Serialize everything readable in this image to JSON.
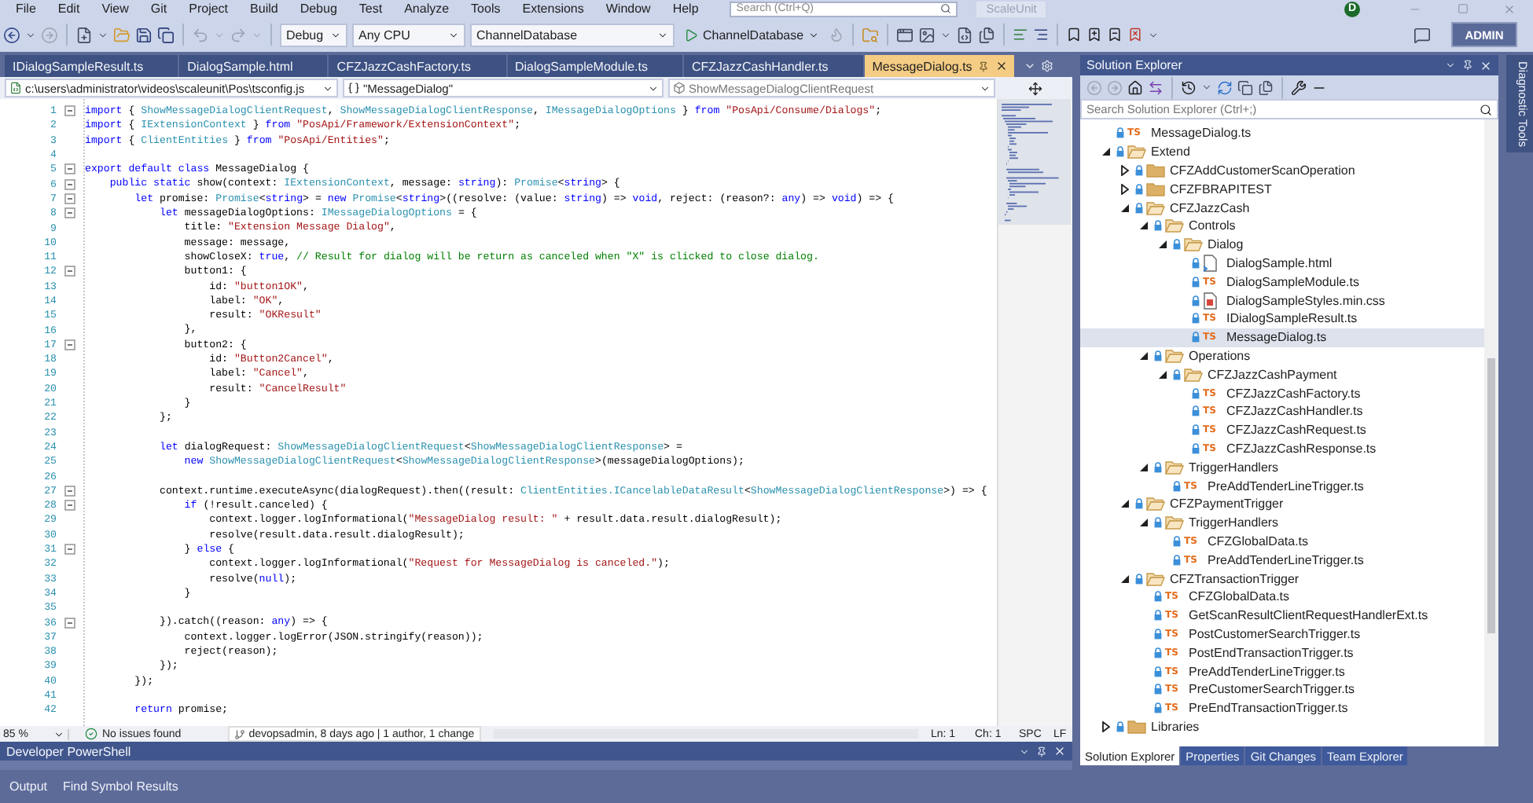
{
  "menu": [
    "File",
    "Edit",
    "View",
    "Git",
    "Project",
    "Build",
    "Debug",
    "Test",
    "Analyze",
    "Tools",
    "Extensions",
    "Window",
    "Help"
  ],
  "search": {
    "placeholder": "Search (Ctrl+Q)"
  },
  "solution_name": "ScaleUnit",
  "account": {
    "initial": "D"
  },
  "toolbar": {
    "configuration": "Debug",
    "platform": "Any CPU",
    "startup_project": "ChannelDatabase",
    "run_target": "ChannelDatabase",
    "admin": "ADMIN"
  },
  "editor_tabs": [
    {
      "label": "IDialogSampleResult.ts",
      "selected": false
    },
    {
      "label": "DialogSample.html",
      "selected": false
    },
    {
      "label": "CFZJazzCashFactory.ts",
      "selected": false
    },
    {
      "label": "DialogSampleModule.ts",
      "selected": false
    },
    {
      "label": "CFZJazzCashHandler.ts",
      "selected": false
    },
    {
      "label": "MessageDialog.ts",
      "selected": true
    }
  ],
  "navigation": {
    "file": "c:\\users\\administrator\\videos\\scaleunit\\Pos\\tsconfig.js",
    "scope": "\"MessageDialog\"",
    "member": "ShowMessageDialogClientRequest"
  },
  "code_lines": [
    {
      "number": "1",
      "foldable": true,
      "segments": [
        {
          "kind": "keyword",
          "text": "import"
        },
        {
          "kind": "plain",
          "text": " { "
        },
        {
          "kind": "type",
          "text": "ShowMessageDialogClientRequest"
        },
        {
          "kind": "plain",
          "text": ", "
        },
        {
          "kind": "type",
          "text": "ShowMessageDialogClientResponse"
        },
        {
          "kind": "plain",
          "text": ", "
        },
        {
          "kind": "type",
          "text": "IMessageDialogOptions"
        },
        {
          "kind": "plain",
          "text": " } "
        },
        {
          "kind": "keyword",
          "text": "from"
        },
        {
          "kind": "string",
          "text": " \"PosApi/Consume/Dialogs\""
        },
        {
          "kind": "plain",
          "text": ";"
        }
      ]
    },
    {
      "number": "2",
      "foldable": false,
      "segments": [
        {
          "kind": "keyword",
          "text": "import"
        },
        {
          "kind": "plain",
          "text": " { "
        },
        {
          "kind": "type",
          "text": "IExtensionContext"
        },
        {
          "kind": "plain",
          "text": " } "
        },
        {
          "kind": "keyword",
          "text": "from"
        },
        {
          "kind": "string",
          "text": " \"PosApi/Framework/ExtensionContext\""
        },
        {
          "kind": "plain",
          "text": ";"
        }
      ]
    },
    {
      "number": "3",
      "foldable": false,
      "segments": [
        {
          "kind": "keyword",
          "text": "import"
        },
        {
          "kind": "plain",
          "text": " { "
        },
        {
          "kind": "type",
          "text": "ClientEntities"
        },
        {
          "kind": "plain",
          "text": " } "
        },
        {
          "kind": "keyword",
          "text": "from"
        },
        {
          "kind": "string",
          "text": " \"PosApi/Entities\""
        },
        {
          "kind": "plain",
          "text": ";"
        }
      ]
    },
    {
      "number": "4",
      "foldable": false
    },
    {
      "number": "5",
      "foldable": true,
      "segments": [
        {
          "kind": "keyword",
          "text": "export default class"
        },
        {
          "kind": "plain",
          "text": " MessageDialog {"
        }
      ]
    },
    {
      "number": "6",
      "foldable": true,
      "segments": [
        {
          "kind": "keyword",
          "text": "    public static"
        },
        {
          "kind": "plain",
          "text": " show(context: "
        },
        {
          "kind": "type",
          "text": "IExtensionContext"
        },
        {
          "kind": "plain",
          "text": ", message: "
        },
        {
          "kind": "keyword",
          "text": "string"
        },
        {
          "kind": "plain",
          "text": "): "
        },
        {
          "kind": "type",
          "text": "Promise"
        },
        {
          "kind": "plain",
          "text": "<"
        },
        {
          "kind": "keyword",
          "text": "string"
        },
        {
          "kind": "plain",
          "text": "> {"
        }
      ]
    },
    {
      "number": "7",
      "foldable": true,
      "segments": [
        {
          "kind": "keyword",
          "text": "        let"
        },
        {
          "kind": "plain",
          "text": " promise: "
        },
        {
          "kind": "type",
          "text": "Promise"
        },
        {
          "kind": "plain",
          "text": "<"
        },
        {
          "kind": "keyword",
          "text": "string"
        },
        {
          "kind": "plain",
          "text": "> = "
        },
        {
          "kind": "keyword",
          "text": "new"
        },
        {
          "kind": "type",
          "text": " Promise"
        },
        {
          "kind": "plain",
          "text": "<"
        },
        {
          "kind": "keyword",
          "text": "string"
        },
        {
          "kind": "plain",
          "text": ">((resolve: (value: "
        },
        {
          "kind": "keyword",
          "text": "string"
        },
        {
          "kind": "plain",
          "text": ") => "
        },
        {
          "kind": "keyword",
          "text": "void"
        },
        {
          "kind": "plain",
          "text": ", reject: (reason?: "
        },
        {
          "kind": "keyword",
          "text": "any"
        },
        {
          "kind": "plain",
          "text": ") => "
        },
        {
          "kind": "keyword",
          "text": "void"
        },
        {
          "kind": "plain",
          "text": ") => {"
        }
      ]
    },
    {
      "number": "8",
      "foldable": true,
      "segments": [
        {
          "kind": "keyword",
          "text": "            let"
        },
        {
          "kind": "plain",
          "text": " messageDialogOptions: "
        },
        {
          "kind": "type",
          "text": "IMessageDialogOptions"
        },
        {
          "kind": "plain",
          "text": " = {"
        }
      ]
    },
    {
      "number": "9",
      "foldable": false,
      "segments": [
        {
          "kind": "plain",
          "text": "                title: "
        },
        {
          "kind": "string",
          "text": "\"Extension Message Dialog\""
        },
        {
          "kind": "plain",
          "text": ","
        }
      ]
    },
    {
      "number": "10",
      "foldable": false,
      "segments": [
        {
          "kind": "plain",
          "text": "                message: message,"
        }
      ]
    },
    {
      "number": "11",
      "foldable": false,
      "segments": [
        {
          "kind": "plain",
          "text": "                showCloseX: "
        },
        {
          "kind": "keyword",
          "text": "true"
        },
        {
          "kind": "plain",
          "text": ", "
        },
        {
          "kind": "comment",
          "text": "// Result for dialog will be return as canceled when \"X\" is clicked to close dialog."
        }
      ]
    },
    {
      "number": "12",
      "foldable": true,
      "segments": [
        {
          "kind": "plain",
          "text": "                button1: {"
        }
      ]
    },
    {
      "number": "13",
      "foldable": false,
      "segments": [
        {
          "kind": "plain",
          "text": "                    id: "
        },
        {
          "kind": "string",
          "text": "\"button1OK\""
        },
        {
          "kind": "plain",
          "text": ","
        }
      ]
    },
    {
      "number": "14",
      "foldable": false,
      "segments": [
        {
          "kind": "plain",
          "text": "                    label: "
        },
        {
          "kind": "string",
          "text": "\"OK\""
        },
        {
          "kind": "plain",
          "text": ","
        }
      ]
    },
    {
      "number": "15",
      "foldable": false,
      "segments": [
        {
          "kind": "plain",
          "text": "                    result: "
        },
        {
          "kind": "string",
          "text": "\"OKResult\""
        }
      ]
    },
    {
      "number": "16",
      "foldable": false,
      "segments": [
        {
          "kind": "plain",
          "text": "                },"
        }
      ]
    },
    {
      "number": "17",
      "foldable": true,
      "segments": [
        {
          "kind": "plain",
          "text": "                button2: {"
        }
      ]
    },
    {
      "number": "18",
      "foldable": false,
      "segments": [
        {
          "kind": "plain",
          "text": "                    id: "
        },
        {
          "kind": "string",
          "text": "\"Button2Cancel\""
        },
        {
          "kind": "plain",
          "text": ","
        }
      ]
    },
    {
      "number": "19",
      "foldable": false,
      "segments": [
        {
          "kind": "plain",
          "text": "                    label: "
        },
        {
          "kind": "string",
          "text": "\"Cancel\""
        },
        {
          "kind": "plain",
          "text": ","
        }
      ]
    },
    {
      "number": "20",
      "foldable": false,
      "segments": [
        {
          "kind": "plain",
          "text": "                    result: "
        },
        {
          "kind": "string",
          "text": "\"CancelResult\""
        }
      ]
    },
    {
      "number": "21",
      "foldable": false,
      "segments": [
        {
          "kind": "plain",
          "text": "                }"
        }
      ]
    },
    {
      "number": "22",
      "foldable": false,
      "segments": [
        {
          "kind": "plain",
          "text": "            };"
        }
      ]
    },
    {
      "number": "23",
      "foldable": false
    },
    {
      "number": "24",
      "foldable": false,
      "segments": [
        {
          "kind": "keyword",
          "text": "            let"
        },
        {
          "kind": "plain",
          "text": " dialogRequest: "
        },
        {
          "kind": "type",
          "text": "ShowMessageDialogClientRequest"
        },
        {
          "kind": "plain",
          "text": "<"
        },
        {
          "kind": "type",
          "text": "ShowMessageDialogClientResponse"
        },
        {
          "kind": "plain",
          "text": "> ="
        }
      ]
    },
    {
      "number": "25",
      "foldable": false,
      "segments": [
        {
          "kind": "keyword",
          "text": "                new"
        },
        {
          "kind": "type",
          "text": " ShowMessageDialogClientRequest"
        },
        {
          "kind": "plain",
          "text": "<"
        },
        {
          "kind": "type",
          "text": "ShowMessageDialogClientResponse"
        },
        {
          "kind": "plain",
          "text": ">(messageDialogOptions);"
        }
      ]
    },
    {
      "number": "26",
      "foldable": false
    },
    {
      "number": "27",
      "foldable": true,
      "segments": [
        {
          "kind": "plain",
          "text": "            context.runtime.executeAsync(dialogRequest).then((result: "
        },
        {
          "kind": "type",
          "text": "ClientEntities.ICancelableDataResult"
        },
        {
          "kind": "plain",
          "text": "<"
        },
        {
          "kind": "type",
          "text": "ShowMessageDialogClientResponse"
        },
        {
          "kind": "plain",
          "text": ">) => {"
        }
      ]
    },
    {
      "number": "28",
      "foldable": true,
      "segments": [
        {
          "kind": "keyword",
          "text": "                if"
        },
        {
          "kind": "plain",
          "text": " (!result.canceled) {"
        }
      ]
    },
    {
      "number": "29",
      "foldable": false,
      "segments": [
        {
          "kind": "plain",
          "text": "                    context.logger.logInformational("
        },
        {
          "kind": "string",
          "text": "\"MessageDialog result: \""
        },
        {
          "kind": "plain",
          "text": " + result.data.result.dialogResult);"
        }
      ]
    },
    {
      "number": "30",
      "foldable": false,
      "segments": [
        {
          "kind": "plain",
          "text": "                    resolve(result.data.result.dialogResult);"
        }
      ]
    },
    {
      "number": "31",
      "foldable": true,
      "segments": [
        {
          "kind": "plain",
          "text": "                } "
        },
        {
          "kind": "keyword",
          "text": "else"
        },
        {
          "kind": "plain",
          "text": " {"
        }
      ]
    },
    {
      "number": "32",
      "foldable": false,
      "segments": [
        {
          "kind": "plain",
          "text": "                    context.logger.logInformational("
        },
        {
          "kind": "string",
          "text": "\"Request for MessageDialog is canceled.\""
        },
        {
          "kind": "plain",
          "text": ");"
        }
      ]
    },
    {
      "number": "33",
      "foldable": false,
      "segments": [
        {
          "kind": "plain",
          "text": "                    resolve("
        },
        {
          "kind": "keyword",
          "text": "null"
        },
        {
          "kind": "plain",
          "text": ");"
        }
      ]
    },
    {
      "number": "34",
      "foldable": false,
      "segments": [
        {
          "kind": "plain",
          "text": "                }"
        }
      ]
    },
    {
      "number": "35",
      "foldable": false
    },
    {
      "number": "36",
      "foldable": true,
      "segments": [
        {
          "kind": "plain",
          "text": "            }).catch((reason: "
        },
        {
          "kind": "keyword",
          "text": "any"
        },
        {
          "kind": "plain",
          "text": ") => {"
        }
      ]
    },
    {
      "number": "37",
      "foldable": false,
      "segments": [
        {
          "kind": "plain",
          "text": "                context.logger.logError(JSON.stringify(reason));"
        }
      ]
    },
    {
      "number": "38",
      "foldable": false,
      "segments": [
        {
          "kind": "plain",
          "text": "                reject(reason);"
        }
      ]
    },
    {
      "number": "39",
      "foldable": false,
      "segments": [
        {
          "kind": "plain",
          "text": "            });"
        }
      ]
    },
    {
      "number": "40",
      "foldable": false,
      "segments": [
        {
          "kind": "plain",
          "text": "        });"
        }
      ]
    },
    {
      "number": "41",
      "foldable": false
    },
    {
      "number": "42",
      "foldable": false,
      "segments": [
        {
          "kind": "keyword",
          "text": "        return"
        },
        {
          "kind": "plain",
          "text": " promise;"
        }
      ]
    }
  ],
  "status": {
    "zoom": "85 %",
    "issues": "No issues found",
    "blame": "devopsadmin, 8 days ago | 1 author, 1 change",
    "line": "Ln: 1",
    "column": "Ch: 1",
    "whitespace": "SPC",
    "line_ending": "LF"
  },
  "bottom_panel": {
    "title": "Developer PowerShell"
  },
  "bottom_tabs": [
    {
      "label": "Output",
      "selected": false
    },
    {
      "label": "Find Symbol Results",
      "selected": false
    }
  ],
  "solution_explorer": {
    "title": "Solution Explorer",
    "search": {
      "placeholder": "Search Solution Explorer (Ctrl+;)"
    },
    "tree": [
      {
        "label": "MessageDialog.ts",
        "kind": "ts",
        "badge": "TS",
        "selected": false
      },
      {
        "label": "Extend",
        "kind": "folder",
        "expanded": true,
        "selected": false,
        "children": [
          {
            "label": "CFZAddCustomerScanOperation",
            "kind": "folder",
            "expanded": false,
            "selected": false
          },
          {
            "label": "CFZFBRAPITEST",
            "kind": "folder",
            "expanded": false,
            "selected": false
          },
          {
            "label": "CFZJazzCash",
            "kind": "folder",
            "expanded": true,
            "selected": false,
            "children": [
              {
                "label": "Controls",
                "kind": "folder",
                "expanded": true,
                "selected": false,
                "children": [
                  {
                    "label": "Dialog",
                    "kind": "folder",
                    "expanded": true,
                    "selected": false,
                    "children": [
                      {
                        "label": "DialogSample.html",
                        "kind": "html",
                        "selected": false
                      },
                      {
                        "label": "DialogSampleModule.ts",
                        "kind": "ts",
                        "badge": "TS",
                        "selected": false
                      },
                      {
                        "label": "DialogSampleStyles.min.css",
                        "kind": "css",
                        "selected": false
                      },
                      {
                        "label": "IDialogSampleResult.ts",
                        "kind": "ts",
                        "badge": "TS",
                        "selected": false
                      },
                      {
                        "label": "MessageDialog.ts",
                        "kind": "ts",
                        "badge": "TS",
                        "selected": true
                      }
                    ]
                  }
                ]
              },
              {
                "label": "Operations",
                "kind": "folder",
                "expanded": true,
                "selected": false,
                "children": [
                  {
                    "label": "CFZJazzCashPayment",
                    "kind": "folder",
                    "expanded": true,
                    "selected": false,
                    "children": [
                      {
                        "label": "CFZJazzCashFactory.ts",
                        "kind": "ts",
                        "badge": "TS",
                        "selected": false
                      },
                      {
                        "label": "CFZJazzCashHandler.ts",
                        "kind": "ts",
                        "badge": "TS",
                        "selected": false
                      },
                      {
                        "label": "CFZJazzCashRequest.ts",
                        "kind": "ts",
                        "badge": "TS",
                        "selected": false
                      },
                      {
                        "label": "CFZJazzCashResponse.ts",
                        "kind": "ts",
                        "badge": "TS",
                        "selected": false
                      }
                    ]
                  }
                ]
              },
              {
                "label": "TriggerHandlers",
                "kind": "folder",
                "expanded": true,
                "selected": false,
                "children": [
                  {
                    "label": "PreAddTenderLineTrigger.ts",
                    "kind": "ts",
                    "badge": "TS",
                    "selected": false
                  }
                ]
              }
            ]
          },
          {
            "label": "CFZPaymentTrigger",
            "kind": "folder",
            "expanded": true,
            "selected": false,
            "children": [
              {
                "label": "TriggerHandlers",
                "kind": "folder",
                "expanded": true,
                "selected": false,
                "children": [
                  {
                    "label": "CFZGlobalData.ts",
                    "kind": "ts",
                    "badge": "TS",
                    "selected": false
                  },
                  {
                    "label": "PreAddTenderLineTrigger.ts",
                    "kind": "ts",
                    "badge": "TS",
                    "selected": false
                  }
                ]
              }
            ]
          },
          {
            "label": "CFZTransactionTrigger",
            "kind": "folder",
            "expanded": true,
            "selected": false,
            "children": [
              {
                "label": "CFZGlobalData.ts",
                "kind": "ts",
                "badge": "TS",
                "selected": false
              },
              {
                "label": "GetScanResultClientRequestHandlerExt.ts",
                "kind": "ts",
                "badge": "TS",
                "selected": false
              },
              {
                "label": "PostCustomerSearchTrigger.ts",
                "kind": "ts",
                "badge": "TS",
                "selected": false
              },
              {
                "label": "PostEndTransactionTrigger.ts",
                "kind": "ts",
                "badge": "TS",
                "selected": false
              },
              {
                "label": "PreAddTenderLineTrigger.ts",
                "kind": "ts",
                "badge": "TS",
                "selected": false
              },
              {
                "label": "PreCustomerSearchTrigger.ts",
                "kind": "ts",
                "badge": "TS",
                "selected": false
              },
              {
                "label": "PreEndTransactionTrigger.ts",
                "kind": "ts",
                "badge": "TS",
                "selected": false
              }
            ]
          }
        ]
      },
      {
        "label": "Libraries",
        "kind": "folder",
        "expanded": false,
        "selected": false
      }
    ],
    "tabs": [
      {
        "label": "Solution Explorer",
        "selected": true
      },
      {
        "label": "Properties",
        "selected": false
      },
      {
        "label": "Git Changes",
        "selected": false
      },
      {
        "label": "Team Explorer",
        "selected": false
      }
    ]
  },
  "side_tabs": [
    {
      "label": "Diagnostic Tools"
    }
  ]
}
